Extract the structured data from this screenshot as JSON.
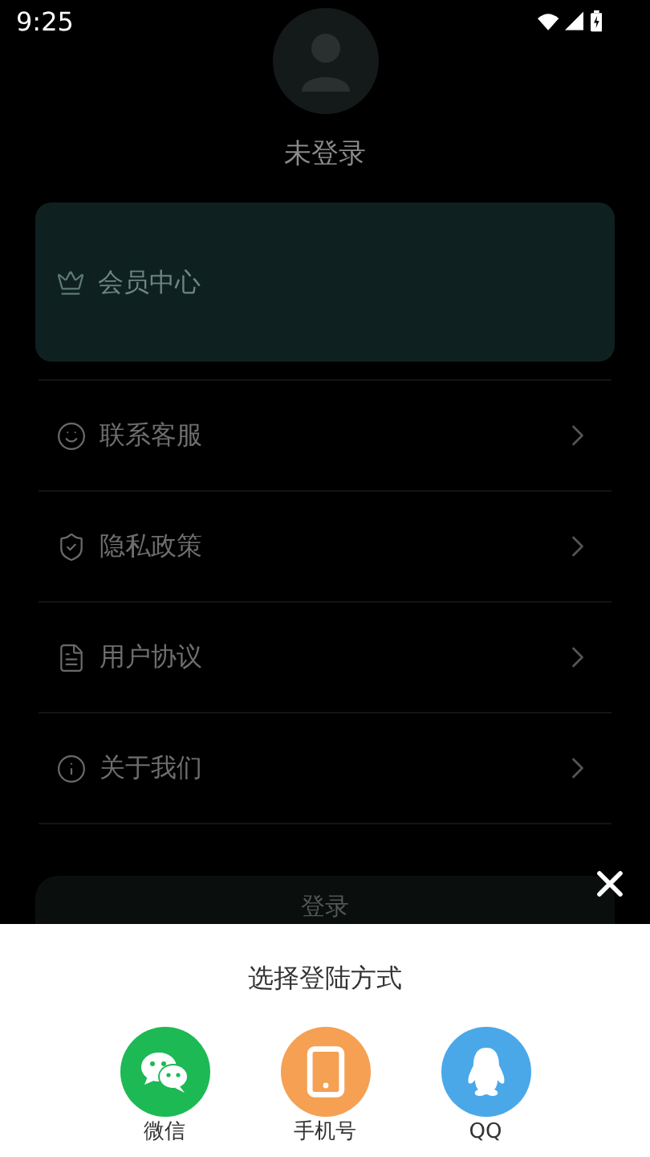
{
  "status_bar": {
    "time": "9:25"
  },
  "profile": {
    "name": "未登录"
  },
  "member_card": {
    "label": "会员中心"
  },
  "menu": [
    {
      "label": "联系客服",
      "kind": "smile"
    },
    {
      "label": "隐私政策",
      "kind": "shield"
    },
    {
      "label": "用户协议",
      "kind": "document"
    },
    {
      "label": "关于我们",
      "kind": "info"
    }
  ],
  "login_button": {
    "label": "登录"
  },
  "login_sheet": {
    "title": "选择登陆方式",
    "options": [
      {
        "label": "微信",
        "kind": "wechat"
      },
      {
        "label": "手机号",
        "kind": "phone"
      },
      {
        "label": "QQ",
        "kind": "qq"
      }
    ]
  }
}
